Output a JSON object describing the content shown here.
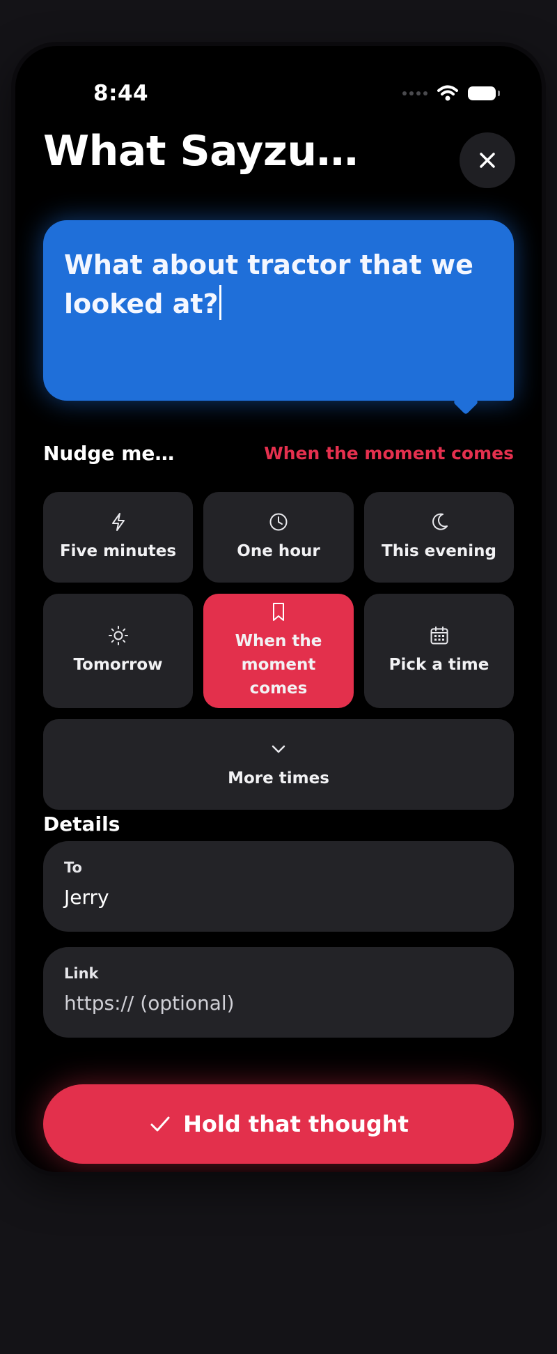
{
  "status": {
    "time": "8:44"
  },
  "header": {
    "title": "What Sayzu…"
  },
  "message": {
    "text": "What about tractor that we looked at?"
  },
  "nudge": {
    "label": "Nudge me…",
    "selected_label": "When the moment comes",
    "options": [
      {
        "label": "Five minutes",
        "icon": "lightning-icon"
      },
      {
        "label": "One hour",
        "icon": "clock-icon"
      },
      {
        "label": "This evening",
        "icon": "moon-icon"
      },
      {
        "label": "Tomorrow",
        "icon": "sun-icon"
      },
      {
        "label": "When the moment comes",
        "icon": "bookmark-icon",
        "selected": true
      },
      {
        "label": "Pick a time",
        "icon": "calendar-icon"
      }
    ],
    "more_label": "More times"
  },
  "details": {
    "label": "Details",
    "to": {
      "label": "To",
      "value": "Jerry"
    },
    "link": {
      "label": "Link",
      "placeholder": "https:// (optional)"
    }
  },
  "cta": {
    "label": "Hold that thought"
  },
  "colors": {
    "accent": "#e3304c",
    "bubble": "#1f6fd9",
    "card": "#232327",
    "background": "#000000"
  }
}
